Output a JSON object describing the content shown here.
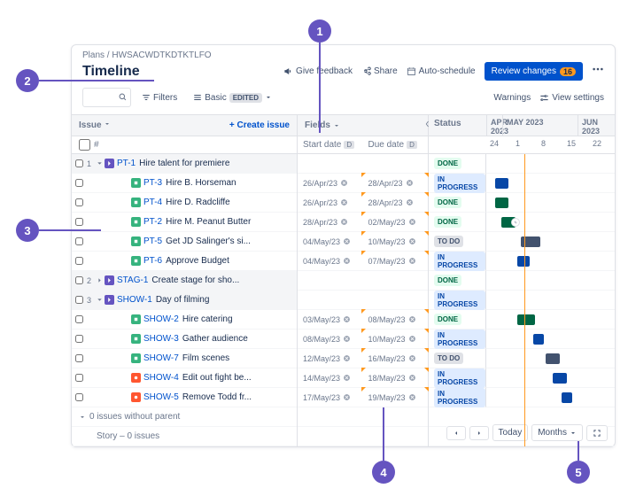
{
  "breadcrumb": {
    "root": "Plans",
    "project": "HWSACWDTKDTKTLFO"
  },
  "title": "Timeline",
  "header": {
    "feedback": "Give feedback",
    "share": "Share",
    "autoschedule": "Auto-schedule",
    "review": "Review changes",
    "review_count": "16"
  },
  "toolbar": {
    "filters": "Filters",
    "basic": "Basic",
    "edited": "EDITED",
    "warnings": "Warnings",
    "viewsettings": "View settings"
  },
  "columns": {
    "issue": "Issue",
    "create": "+ Create issue",
    "hash": "#",
    "fields": "Fields",
    "startdate": "Start date",
    "duedate": "Due date",
    "d": "D",
    "status": "Status"
  },
  "months": {
    "apr": "APR 2023",
    "may": "MAY 2023",
    "jun": "JUN 2023"
  },
  "days": [
    "24",
    "1",
    "8",
    "15",
    "22"
  ],
  "statuses": {
    "done": "DONE",
    "inprogress": "IN PROGRESS",
    "todo": "TO DO"
  },
  "issues": [
    {
      "num": "1",
      "type": "epic",
      "key": "PT-1",
      "summary": "Hire talent for premiere",
      "start": "",
      "due": "",
      "status": "done",
      "parent": true,
      "expanded": true
    },
    {
      "type": "story",
      "key": "PT-3",
      "summary": "Hire B. Horseman",
      "start": "26/Apr/23",
      "due": "28/Apr/23",
      "status": "inprogress",
      "indent": 2
    },
    {
      "type": "story",
      "key": "PT-4",
      "summary": "Hire D. Radcliffe",
      "start": "26/Apr/23",
      "due": "28/Apr/23",
      "status": "done",
      "indent": 2
    },
    {
      "type": "story",
      "key": "PT-2",
      "summary": "Hire M. Peanut Butter",
      "start": "28/Apr/23",
      "due": "02/May/23",
      "status": "done",
      "indent": 2
    },
    {
      "type": "story",
      "key": "PT-5",
      "summary": "Get JD Salinger's si...",
      "start": "04/May/23",
      "due": "10/May/23",
      "status": "todo",
      "indent": 2
    },
    {
      "type": "story",
      "key": "PT-6",
      "summary": "Approve Budget",
      "start": "04/May/23",
      "due": "07/May/23",
      "status": "inprogress",
      "indent": 2
    },
    {
      "num": "2",
      "type": "epic",
      "key": "STAG-1",
      "summary": "Create stage for sho...",
      "start": "",
      "due": "",
      "status": "done",
      "parent": true,
      "expanded": false
    },
    {
      "num": "3",
      "type": "epic",
      "key": "SHOW-1",
      "summary": "Day of filming",
      "start": "",
      "due": "",
      "status": "inprogress",
      "parent": true,
      "expanded": true
    },
    {
      "type": "story",
      "key": "SHOW-2",
      "summary": "Hire catering",
      "start": "03/May/23",
      "due": "08/May/23",
      "status": "done",
      "indent": 2
    },
    {
      "type": "story",
      "key": "SHOW-3",
      "summary": "Gather audience",
      "start": "08/May/23",
      "due": "10/May/23",
      "status": "inprogress",
      "indent": 2
    },
    {
      "type": "story",
      "key": "SHOW-7",
      "summary": "Film scenes",
      "start": "12/May/23",
      "due": "16/May/23",
      "status": "todo",
      "indent": 2
    },
    {
      "type": "bug",
      "key": "SHOW-4",
      "summary": "Edit out fight be...",
      "start": "14/May/23",
      "due": "18/May/23",
      "status": "inprogress",
      "indent": 2
    },
    {
      "type": "bug",
      "key": "SHOW-5",
      "summary": "Remove Todd fr...",
      "start": "17/May/23",
      "due": "19/May/23",
      "status": "inprogress",
      "indent": 2
    }
  ],
  "footer": {
    "noparent": "0 issues without parent",
    "story": "Story – 0 issues"
  },
  "controls": {
    "today": "Today",
    "months": "Months"
  },
  "callouts": {
    "1": "1",
    "2": "2",
    "3": "3",
    "4": "4",
    "5": "5"
  }
}
